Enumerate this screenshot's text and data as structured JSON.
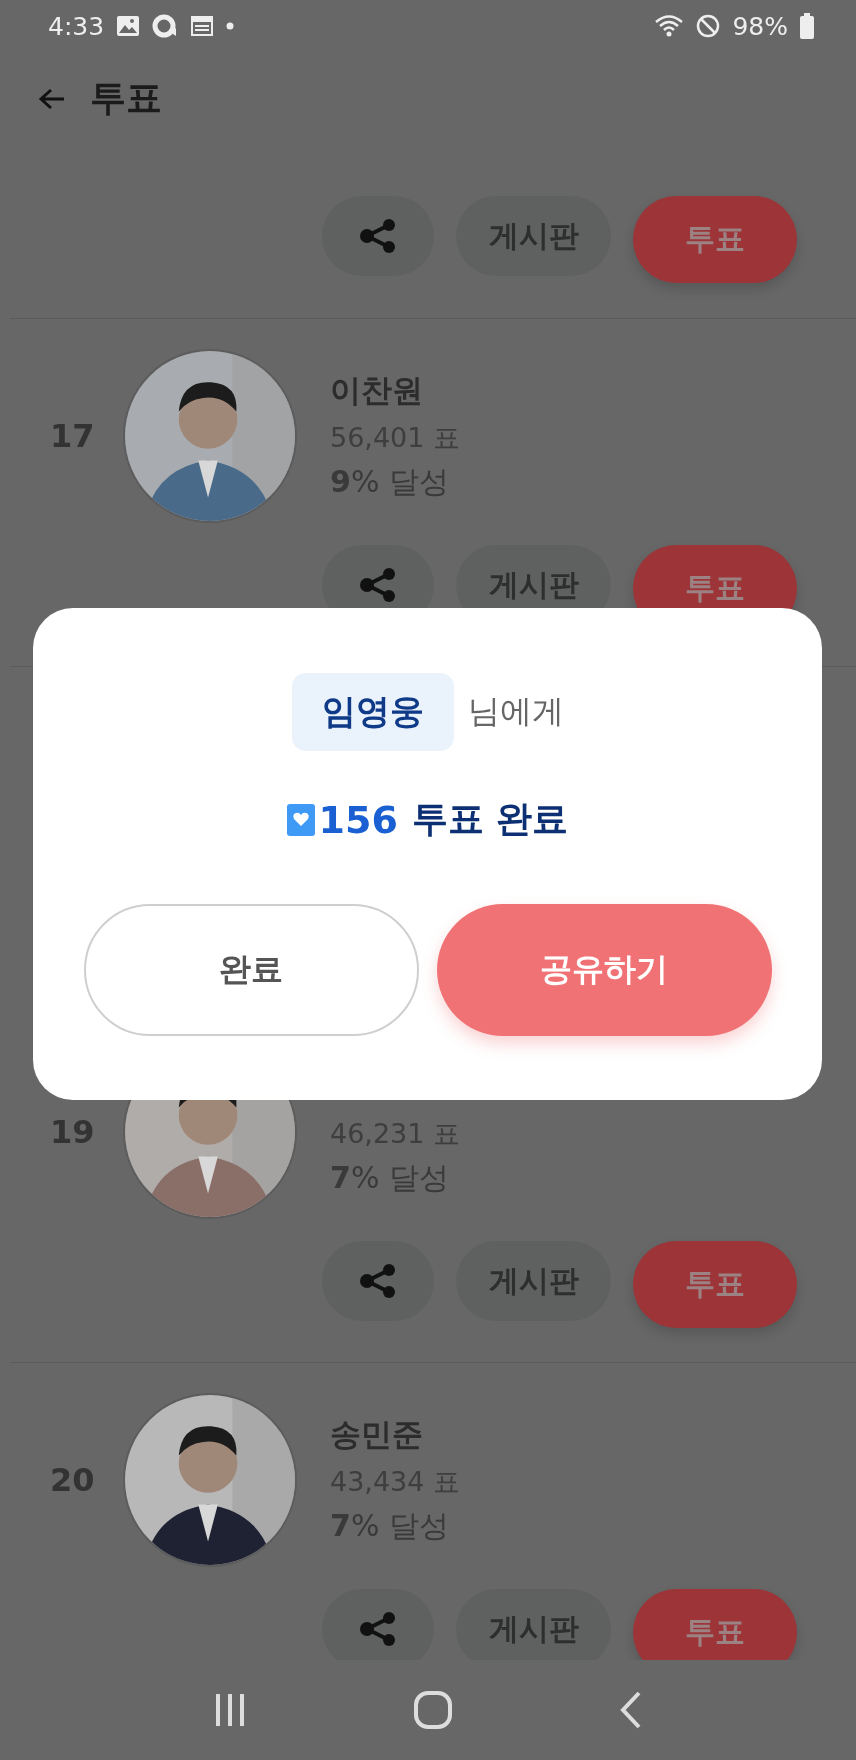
{
  "status_bar": {
    "time": "4:33",
    "battery": "98%"
  },
  "header": {
    "title": "투표"
  },
  "rows": [
    {
      "buttons": {
        "board": "게시판",
        "vote": "투표"
      }
    },
    {
      "rank": "17",
      "name": "이찬원",
      "votes": "56,401 표",
      "achievement": "**9**% 달성",
      "buttons": {
        "board": "게시판",
        "vote": "투표"
      }
    },
    {
      "rank": "19",
      "votes": "46,231 표",
      "achievement": "**7**% 달성",
      "buttons": {
        "board": "게시판",
        "vote": "투표"
      }
    },
    {
      "rank": "20",
      "name": "송민준",
      "votes": "43,434 표",
      "achievement": "**7**% 달성",
      "buttons": {
        "board": "게시판",
        "vote": "투표"
      }
    }
  ],
  "dialog": {
    "recipient": "임영웅",
    "recipient_suffix": "님에게",
    "count": "156",
    "count_suffix": "투표 완료",
    "buttons": [
      {
        "label": "완료",
        "kind": "secondary"
      },
      {
        "label": "공유하기",
        "kind": "primary"
      }
    ]
  }
}
